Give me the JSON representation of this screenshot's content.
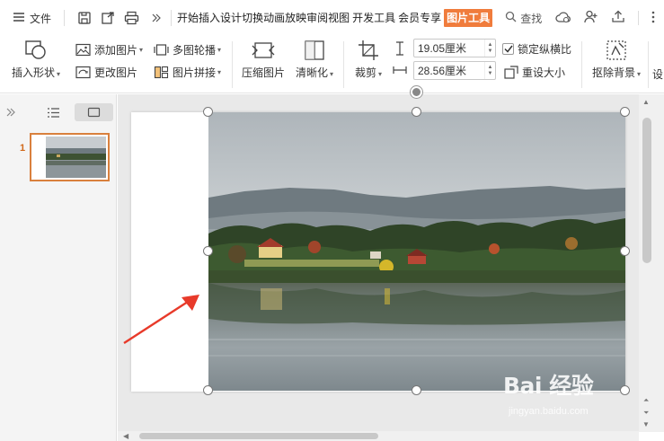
{
  "menubar": {
    "file_label": "文件",
    "tabs": [
      "开始",
      "插入",
      "设计",
      "切换",
      "动画",
      "放映",
      "审阅",
      "视图",
      "开发工具",
      "会员专享"
    ],
    "active_tab": "图片工具",
    "search_label": "查找"
  },
  "ribbon": {
    "insert_shape": "插入形状",
    "add_picture": "添加图片",
    "change_picture": "更改图片",
    "multi_picture_carousel": "多图轮播",
    "picture_stitch": "图片拼接",
    "compress_picture": "压缩图片",
    "sharpen": "清晰化",
    "crop": "裁剪",
    "height_value": "19.05厘米",
    "width_value": "28.56厘米",
    "lock_aspect_ratio": "锁定纵横比",
    "lock_aspect_checked": true,
    "reset_size": "重设大小",
    "remove_background": "抠除背景",
    "set_partial": "设"
  },
  "slides_panel": {
    "slide_number": "1"
  },
  "watermark": {
    "brand": "Bai 经验",
    "url": "jingyan.baidu.com"
  },
  "colors": {
    "accent": "#f07c3c",
    "thumb_border": "#d9803d",
    "annotation_arrow": "#e83a2a"
  }
}
